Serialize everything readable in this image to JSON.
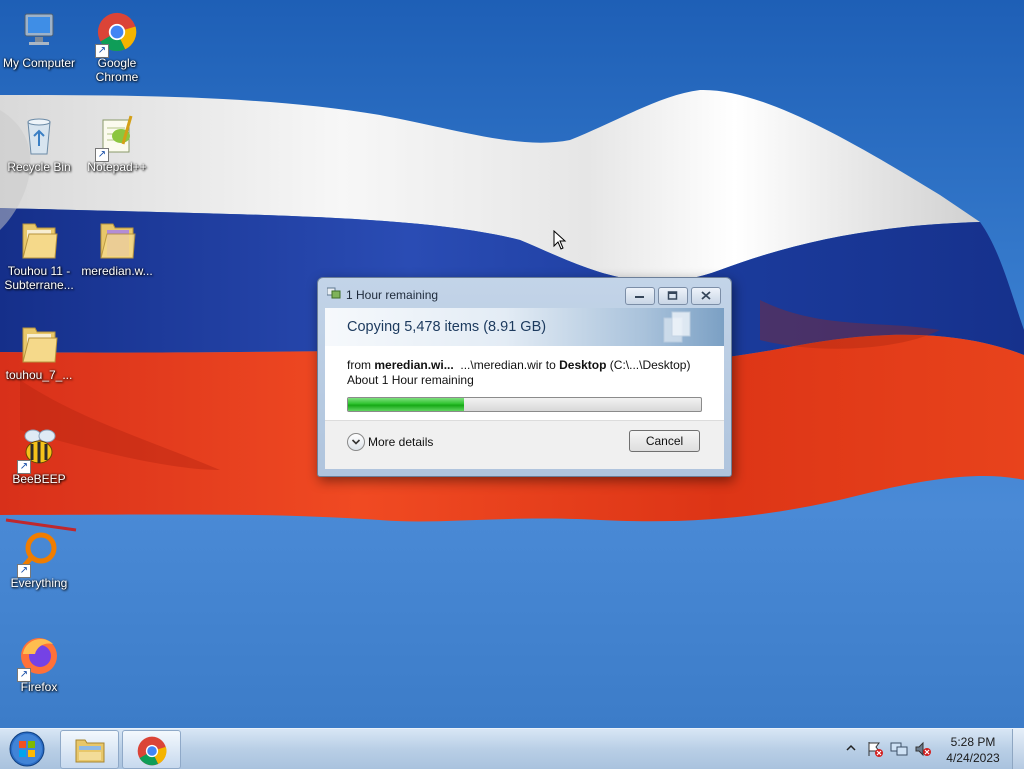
{
  "desktop": {
    "icons": [
      {
        "label": "My Computer",
        "icon": "computer-icon",
        "shortcut": false
      },
      {
        "label": "Google Chrome",
        "icon": "chrome-icon",
        "shortcut": true
      },
      {
        "label": "Recycle Bin",
        "icon": "recycle-bin-icon",
        "shortcut": false
      },
      {
        "label": "Notepad++",
        "icon": "notepad-plus-plus-icon",
        "shortcut": true
      },
      {
        "label": "Touhou 11 - Subterrane...",
        "icon": "folder-icon",
        "shortcut": false
      },
      {
        "label": "meredian.w...",
        "icon": "folder-icon",
        "shortcut": false
      },
      {
        "label": "touhou_7_...",
        "icon": "folder-icon",
        "shortcut": false
      },
      {
        "label": "BeeBEEP",
        "icon": "bee-icon",
        "shortcut": true
      },
      {
        "label": "Everything",
        "icon": "everything-search-icon",
        "shortcut": true
      },
      {
        "label": "Firefox",
        "icon": "firefox-icon",
        "shortcut": true
      }
    ]
  },
  "dialog": {
    "title": "1 Hour remaining",
    "heading": "Copying 5,478 items (8.91 GB)",
    "from_prefix": "from",
    "from_source": "meredian.wi...",
    "from_path": "...\\meredian.wir",
    "to_word": "to",
    "destination": "Desktop",
    "destination_path": "(C:\\...\\Desktop)",
    "time_remaining": "About 1 Hour remaining",
    "progress_percent": 33,
    "more_details_label": "More details",
    "cancel_label": "Cancel",
    "minimize_icon": "minimize-icon",
    "maximize_icon": "maximize-icon",
    "close_icon": "close-icon"
  },
  "taskbar": {
    "start_icon": "windows-start-icon",
    "apps": [
      {
        "name": "Windows Explorer",
        "icon": "explorer-folder-icon",
        "active": true
      },
      {
        "name": "Google Chrome",
        "icon": "chrome-icon",
        "active": false
      }
    ],
    "tray": [
      "show-hidden-icons-chevron",
      "action-center-flag-icon",
      "network-icon",
      "volume-muted-icon"
    ],
    "time": "5:28 PM",
    "date": "4/24/2023"
  },
  "colors": {
    "progress_green": "#15a815",
    "flag_white": "#f4f4f4",
    "flag_blue": "#1f43a6",
    "flag_red": "#e4381e",
    "sky": "#3a7fd0"
  }
}
